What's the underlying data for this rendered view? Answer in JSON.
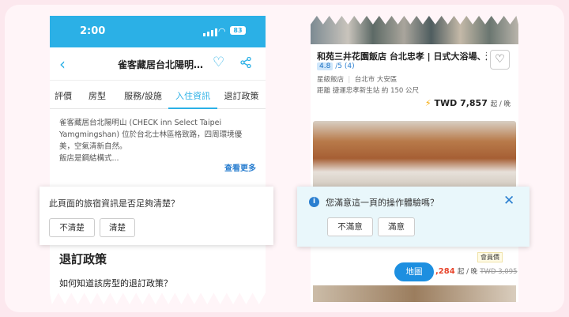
{
  "left_phone": {
    "status_time": "2:00",
    "battery": "83",
    "nav_title": "雀客藏居台北陽明…",
    "tabs": [
      "評價",
      "房型",
      "服務/設施",
      "入住資訊",
      "退訂政策"
    ],
    "active_tab": "入住資訊",
    "description_lines": [
      "雀客藏居台北陽明山 (CHECK inn Select Taipei",
      "Yamgmingshan) 位於台北士林區格致路，四周環境優",
      "美，空氣清新自然。",
      "飯店是鋼結構式..."
    ],
    "see_more": "查看更多",
    "policy_heading": "退訂政策",
    "policy_question": "如何知道該房型的退訂政策？"
  },
  "left_survey": {
    "question": "此頁面的旅宿資訊是否足夠清楚？",
    "no_label": "不清楚",
    "yes_label": "清楚"
  },
  "right_phone": {
    "hotel_name": "和苑三井花園飯店 台北忠孝 | 日式大浴場、連…",
    "rating_score": "4.8",
    "rating_suffix": "/5",
    "rating_count": "(4)",
    "star_label": "星級飯店",
    "location": "台北市 大安區",
    "distance": "距離 捷運忠孝新生站 約 150 公尺",
    "price": "TWD 7,857",
    "price_unit": "起 / 晚",
    "member_badge": "會員價",
    "map_button": "地圖",
    "price2": ",284",
    "price2_unit": "起 / 晚",
    "price2_old": "TWD 3,095"
  },
  "right_survey": {
    "question": "您滿意這一頁的操作體驗嗎？",
    "no_label": "不滿意",
    "yes_label": "滿意"
  },
  "colors": {
    "brand_blue": "#2bb0e6",
    "link_blue": "#2b7fd0",
    "accent_orange": "#f5a700",
    "price_red": "#e8452c"
  }
}
